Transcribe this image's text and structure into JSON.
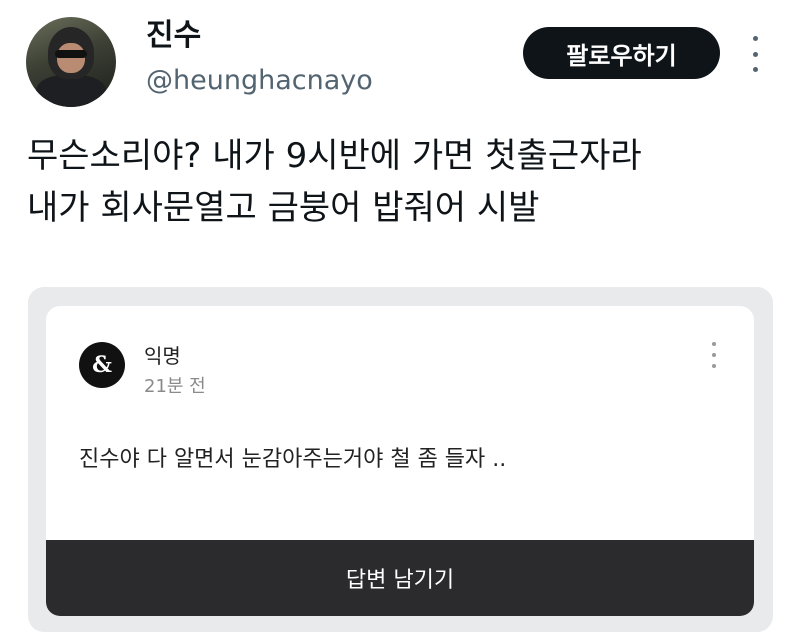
{
  "profile": {
    "display_name": "진수",
    "handle": "@heunghacnayo"
  },
  "header": {
    "follow_label": "팔로우하기",
    "more_icon": "more-vertical-icon"
  },
  "tweet": {
    "lines": [
      "무슨소리야? 내가 9시반에 가면 첫출근자라",
      "내가 회사문열고 금붕어 밥줘어 시발"
    ]
  },
  "embedded_post": {
    "logo_text": "&",
    "author": "익명",
    "time": "21분 전",
    "body": "진수야 다 알면서 눈감아주는거야 철 좀 들자 ..",
    "reply_label": "답변 남기기"
  },
  "colors": {
    "follow_button_bg": "#0f1419",
    "handle_text": "#536471",
    "reply_bar_bg": "#2b2b2d",
    "media_frame_bg": "#e9eaec"
  }
}
